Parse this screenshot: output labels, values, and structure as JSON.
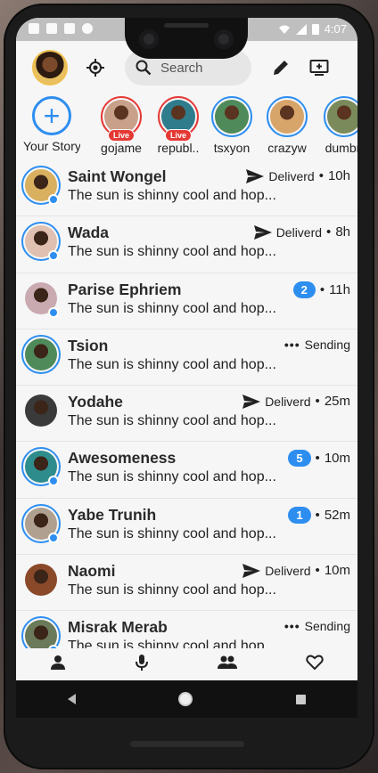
{
  "statusbar": {
    "time": "4:07"
  },
  "search": {
    "placeholder": "Search"
  },
  "stories": [
    {
      "name": "Your Story",
      "type": "add"
    },
    {
      "name": "gojame",
      "live": true,
      "live_label": "Live",
      "color": "#c9a08a"
    },
    {
      "name": "republ..",
      "live": true,
      "live_label": "Live",
      "color": "#2e7c8c"
    },
    {
      "name": "tsxyon",
      "live": false,
      "color": "#4f8a5a"
    },
    {
      "name": "crazyw",
      "live": false,
      "color": "#d7a46a"
    },
    {
      "name": "dumbn",
      "live": false,
      "color": "#7a8a5a"
    }
  ],
  "chats": [
    {
      "name": "Saint Wongel",
      "message": "The sun is shinny cool and hop...",
      "status": "sent",
      "status_text": "Deliverd",
      "time": "10h",
      "online": true,
      "ring": true,
      "color": "#d8b060"
    },
    {
      "name": "Wada",
      "message": "The sun is shinny cool and hop...",
      "status": "sent",
      "status_text": "Deliverd",
      "time": "8h",
      "online": true,
      "ring": true,
      "color": "#e0c0b0"
    },
    {
      "name": "Parise Ephriem",
      "message": "The sun is shinny cool and hop...",
      "status": "unread",
      "unread": "2",
      "time": "11h",
      "online": true,
      "ring": false,
      "color": "#c9aab0"
    },
    {
      "name": "Tsion",
      "message": "The sun is shinny cool and hop...",
      "status": "sending",
      "status_text": "Sending",
      "time": "",
      "online": false,
      "ring": true,
      "color": "#4f8a5a"
    },
    {
      "name": "Yodahe",
      "message": "The sun is shinny cool and hop...",
      "status": "sent",
      "status_text": "Deliverd",
      "time": "25m",
      "online": false,
      "ring": false,
      "color": "#3a3a3a"
    },
    {
      "name": "Awesomeness",
      "message": "The sun is shinny cool and hop...",
      "status": "unread",
      "unread": "5",
      "time": "10m",
      "online": true,
      "ring": true,
      "color": "#2e8c8c"
    },
    {
      "name": "Yabe Trunih",
      "message": "The sun is shinny cool and hop...",
      "status": "unread",
      "unread": "1",
      "time": "52m",
      "online": true,
      "ring": true,
      "color": "#b0a090"
    },
    {
      "name": "Naomi",
      "message": "The sun is shinny cool and hop...",
      "status": "sent",
      "status_text": "Deliverd",
      "time": "10m",
      "online": false,
      "ring": false,
      "color": "#8a4a2a"
    },
    {
      "name": "Misrak Merab",
      "message": "The sun is shinny cool and hop...",
      "status": "sending",
      "status_text": "Sending",
      "time": "",
      "online": true,
      "ring": true,
      "color": "#6a7a5a"
    }
  ],
  "bottom_nav": [
    "person-icon",
    "mic-icon",
    "people-icon",
    "heart-icon"
  ],
  "colors": {
    "accent": "#2d8ef0",
    "live": "#e53935"
  }
}
